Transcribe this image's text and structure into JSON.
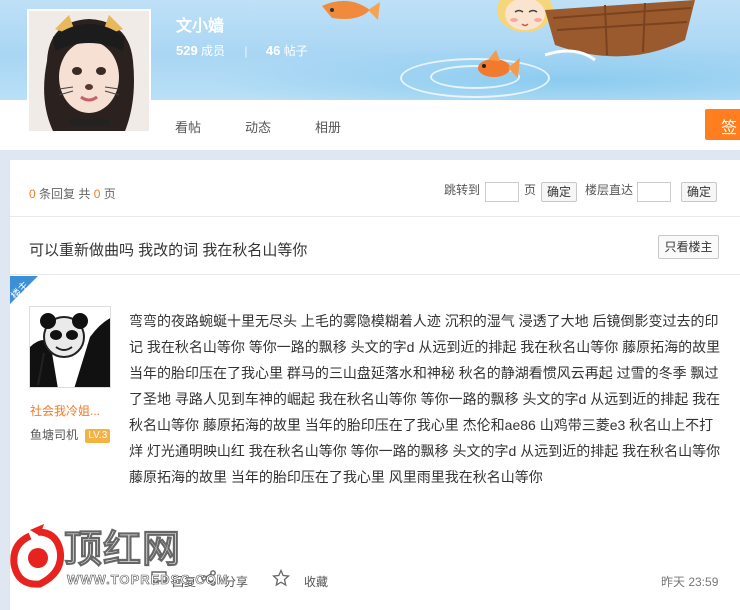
{
  "forum": {
    "name": "文小嫱",
    "members_count": "529",
    "members_label": "成员",
    "posts_count": "46",
    "posts_label": "帖子"
  },
  "nav": {
    "items": [
      "看帖",
      "动态",
      "相册"
    ],
    "sign_label": "签"
  },
  "pager": {
    "reply_count": "0",
    "reply_label": "条回复 共",
    "page_count": "0",
    "page_label": "页",
    "jump_label": "跳转到",
    "page_unit": "页",
    "confirm_label": "确定",
    "floor_label": "楼层直达",
    "floor_confirm_label": "确定"
  },
  "thread": {
    "title": "可以重新做曲吗 我改的词 我在秋名山等你",
    "only_host_label": "只看楼主"
  },
  "post": {
    "host_badge": "楼主",
    "user_name": "社会我冷姐...",
    "user_title": "鱼塘司机",
    "user_level": "LV.3",
    "content": "弯弯的夜路蜿蜒十里无尽头 上毛的雾隐模糊着人迹 沉积的湿气 浸透了大地 后镜倒影变过去的印记 我在秋名山等你 等你一路的飘移 头文的字d 从远到近的排起 我在秋名山等你 藤原拓海的故里 当年的胎印压在了我心里 群马的三山盘延落水和神秘 秋名的静湖看惯风云再起 过雪的冬季 飘过了圣地 寻路人见到车神的崛起 我在秋名山等你 等你一路的飘移 头文的字d 从远到近的排起 我在秋名山等你 藤原拓海的故里 当年的胎印压在了我心里 杰伦和ae86 山鸡带三菱e3 秋名山上不打烊 灯光通明映山红 我在秋名山等你 等你一路的飘移 头文的字d 从远到近的排起 我在秋名山等你 藤原拓海的故里 当年的胎印压在了我心里 风里雨里我在秋名山等你",
    "action_reply": "回复",
    "action_share": "分享",
    "action_collect": "收藏",
    "time": "昨天 23:59"
  },
  "watermark": {
    "text": "顶红网",
    "url": "WWW.TOPREDSC.COM"
  },
  "colors": {
    "accent_orange": "#ff7e20",
    "link_orange": "#f07a27",
    "host_blue": "#3d8fd6",
    "watermark_red": "#e6231f"
  }
}
